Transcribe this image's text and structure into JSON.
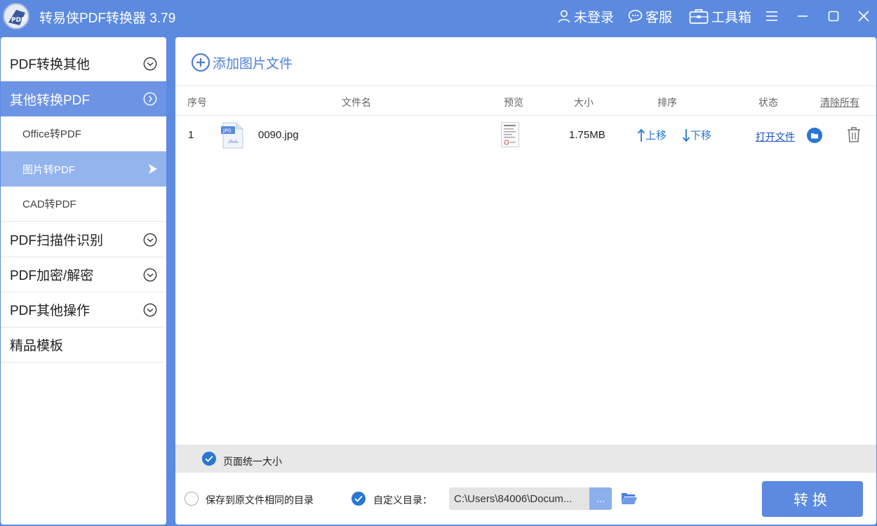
{
  "app": {
    "title": "转易侠PDF转换器 3.79",
    "logo_text": "PDF"
  },
  "header": {
    "login_label": "未登录",
    "service_label": "客服",
    "toolbox_label": "工具箱"
  },
  "sidebar": {
    "items": [
      {
        "label": "PDF转换其他",
        "state": "collapsed"
      },
      {
        "label": "其他转换PDF",
        "state": "expanded"
      },
      {
        "label": "Office转PDF",
        "sub": true
      },
      {
        "label": "图片转PDF",
        "sub": true,
        "selected": true
      },
      {
        "label": "CAD转PDF",
        "sub": true
      },
      {
        "label": "PDF扫描件识别",
        "state": "collapsed"
      },
      {
        "label": "PDF加密/解密",
        "state": "collapsed"
      },
      {
        "label": "PDF其他操作",
        "state": "collapsed"
      },
      {
        "label": "精品模板"
      }
    ]
  },
  "main": {
    "add_label": "添加图片文件",
    "columns": {
      "index": "序号",
      "filename": "文件名",
      "preview": "预览",
      "size": "大小",
      "order": "排序",
      "status": "状态",
      "clear_all": "清除所有"
    },
    "files": [
      {
        "index": "1",
        "type_badge": "JPG",
        "name": "0090.jpg",
        "size": "1.75MB",
        "move_up": "上移",
        "move_down": "下移",
        "open_file": "打开文件"
      }
    ],
    "options": {
      "uniform_page_size": "页面统一大小",
      "save_same_dir": "保存到原文件相同的目录",
      "custom_dir": "自定义目录：",
      "path_value": "C:\\Users\\84006\\Docum...",
      "browse_label": "...",
      "convert_label": "转换"
    }
  },
  "colors": {
    "accent": "#5b8ae0",
    "active_row": "#6c93e4",
    "selected_sub": "#94b4ee",
    "check": "#2a76d2"
  }
}
